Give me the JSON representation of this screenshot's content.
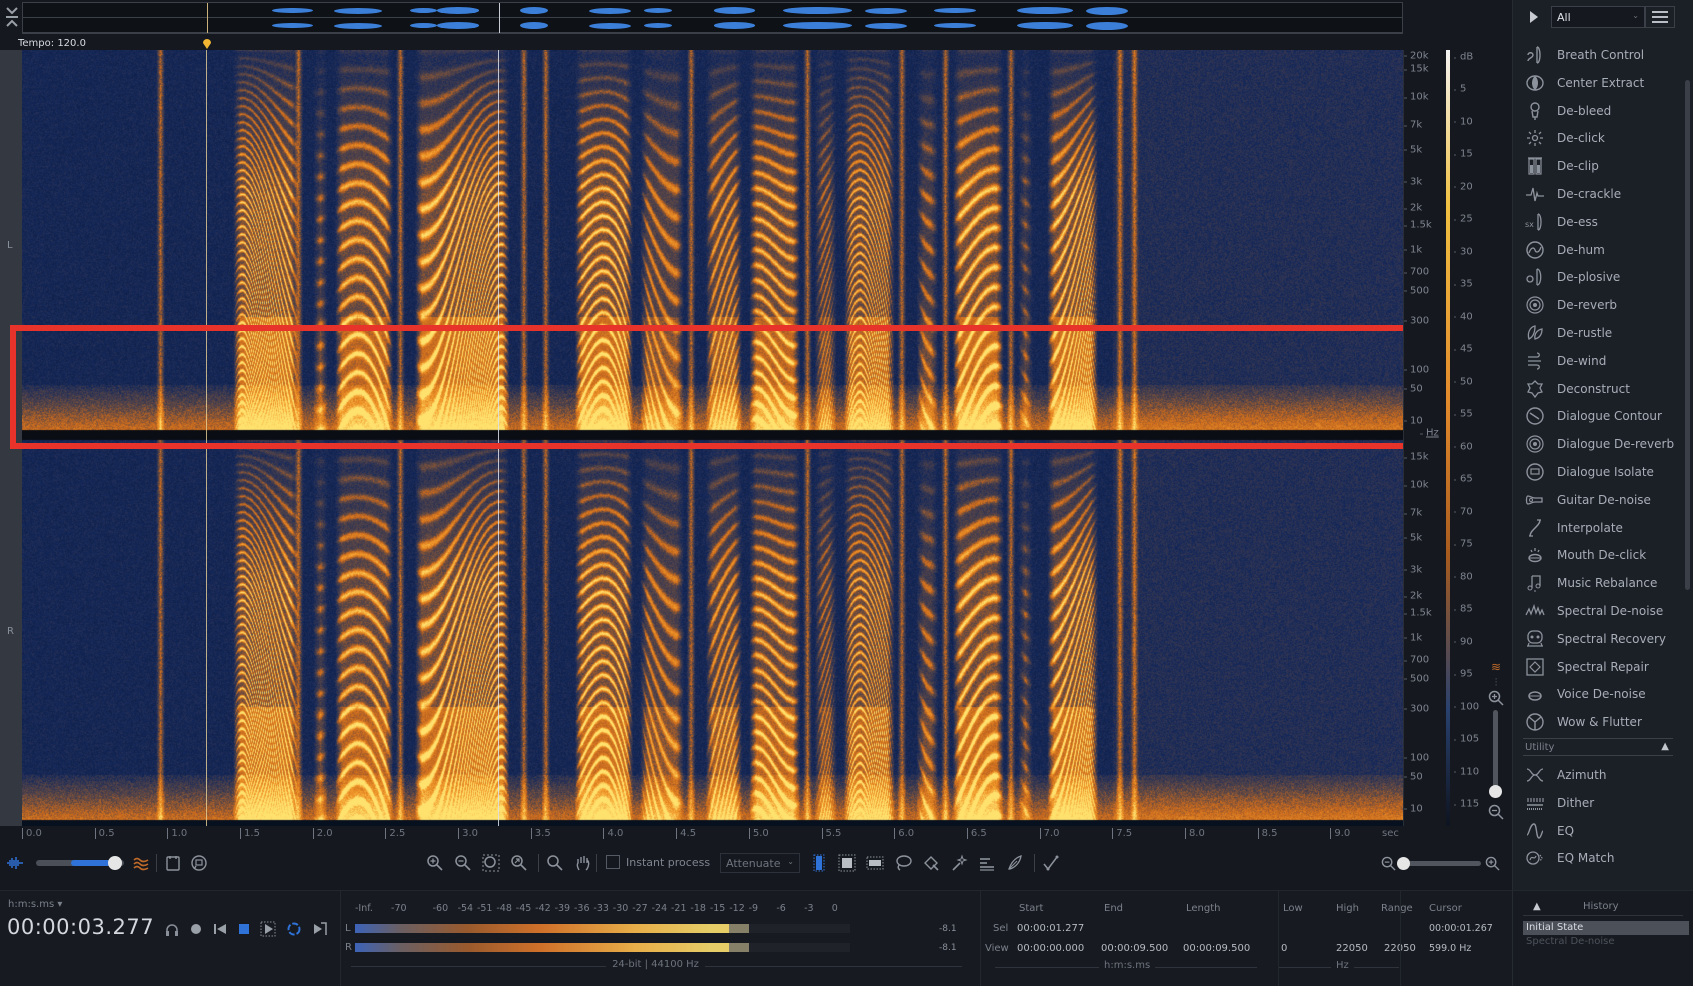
{
  "overview": {
    "collapse_icon": "collapse-expand-icon",
    "segments": [
      {
        "start": 0.18,
        "end": 0.21,
        "h": 0.5
      },
      {
        "start": 0.225,
        "end": 0.26,
        "h": 0.6
      },
      {
        "start": 0.28,
        "end": 0.3,
        "h": 0.4
      },
      {
        "start": 0.3,
        "end": 0.33,
        "h": 0.7
      },
      {
        "start": 0.36,
        "end": 0.38,
        "h": 0.8
      },
      {
        "start": 0.41,
        "end": 0.44,
        "h": 0.6
      },
      {
        "start": 0.45,
        "end": 0.47,
        "h": 0.4
      },
      {
        "start": 0.5,
        "end": 0.53,
        "h": 0.7
      },
      {
        "start": 0.55,
        "end": 0.6,
        "h": 0.9
      },
      {
        "start": 0.61,
        "end": 0.64,
        "h": 0.6
      },
      {
        "start": 0.66,
        "end": 0.69,
        "h": 0.5
      },
      {
        "start": 0.72,
        "end": 0.76,
        "h": 0.9
      },
      {
        "start": 0.77,
        "end": 0.8,
        "h": 1.0
      }
    ]
  },
  "tempo": {
    "label": "Tempo: 120.0"
  },
  "channels": {
    "left": "L",
    "right": "R"
  },
  "spectrogram": {
    "duration_sec": 9.5,
    "cursor_sec": 1.267,
    "playhead_sec": 3.277,
    "selection": {
      "label": "Selected frequency band (red box)",
      "low_hz": 10,
      "high_hz": 300
    }
  },
  "freq_axis": {
    "top_channel": [
      "20k",
      "15k",
      "10k",
      "7k",
      "5k",
      "3k",
      "2k",
      "1.5k",
      "1k",
      "700",
      "500",
      "300",
      "100",
      "50",
      "10"
    ],
    "bottom_channel": [
      "15k",
      "10k",
      "7k",
      "5k",
      "3k",
      "2k",
      "1.5k",
      "1k",
      "700",
      "500",
      "300",
      "100",
      "50",
      "10"
    ],
    "unit": "Hz"
  },
  "db_axis": {
    "unit": "dB",
    "labels": [
      "5",
      "10",
      "15",
      "20",
      "25",
      "30",
      "35",
      "40",
      "45",
      "50",
      "55",
      "60",
      "65",
      "70",
      "75",
      "80",
      "85",
      "90",
      "95",
      "100",
      "105",
      "110",
      "115"
    ]
  },
  "time_ruler": {
    "labels": [
      "0.0",
      "0.5",
      "1.0",
      "1.5",
      "2.0",
      "2.5",
      "3.0",
      "3.5",
      "4.0",
      "4.5",
      "5.0",
      "5.5",
      "6.0",
      "6.5",
      "7.0",
      "7.5",
      "8.0",
      "8.5",
      "9.0"
    ],
    "unit": "sec"
  },
  "toolbar": {
    "waveform_icon": "waveform-spectrogram-blend-icon",
    "spectrogram_icon": "spectrogram-icon",
    "blend_level": 0.9,
    "instant_process_label": "Instant process",
    "instant_process_checked": false,
    "mode_value": "Attenuate",
    "zoom_tools": [
      "zoom-in-icon",
      "zoom-out-icon",
      "zoom-selection-icon",
      "zoom-fit-icon",
      "magnify-icon",
      "hand-icon"
    ],
    "select_tools": [
      "time-select-icon",
      "time-freq-select-icon",
      "freq-select-icon",
      "lasso-icon",
      "brush-icon",
      "magic-wand-icon",
      "harmonic-select-icon",
      "find-similar-icon",
      "pencil-curve-icon"
    ]
  },
  "transport": {
    "time_format": "h:m:s.ms ▾",
    "time": "00:00:03.277",
    "buttons": [
      "headphones-icon",
      "record-icon",
      "rewind-icon",
      "stop-icon",
      "play-selection-icon",
      "loop-icon",
      "play-from-cursor-icon"
    ]
  },
  "meter": {
    "scale": [
      "-Inf.",
      "-70",
      "-60",
      "-54",
      "-51",
      "-48",
      "-45",
      "-42",
      "-39",
      "-36",
      "-33",
      "-30",
      "-27",
      "-24",
      "-21",
      "-18",
      "-15",
      "-12",
      "-9",
      "-6",
      "-3",
      "0"
    ],
    "left": {
      "label": "L",
      "level_db": -12,
      "peak_db": -9,
      "value": "-8.1"
    },
    "right": {
      "label": "R",
      "level_db": -12,
      "peak_db": -9,
      "value": "-8.1"
    },
    "format": "24-bit | 44100 Hz"
  },
  "selection_info": {
    "headers": {
      "start": "Start",
      "end": "End",
      "length": "Length",
      "low": "Low",
      "high": "High",
      "range": "Range",
      "cursor": "Cursor"
    },
    "sel": {
      "label": "Sel",
      "start": "00:00:01.277"
    },
    "view": {
      "label": "View",
      "start": "00:00:00.000",
      "end": "00:00:09.500",
      "length": "00:00:09.500",
      "low": "0",
      "high": "22050",
      "range": "22050"
    },
    "cursor_time": "00:00:01.267",
    "cursor_freq": "599.0 Hz",
    "time_unit": "h:m:s.ms",
    "freq_unit": "Hz"
  },
  "modules": {
    "filter_value": "All",
    "items": [
      {
        "label": "Breath Control",
        "icon": "breath-control-icon"
      },
      {
        "label": "Center Extract",
        "icon": "center-extract-icon"
      },
      {
        "label": "De-bleed",
        "icon": "de-bleed-icon"
      },
      {
        "label": "De-click",
        "icon": "de-click-icon"
      },
      {
        "label": "De-clip",
        "icon": "de-clip-icon"
      },
      {
        "label": "De-crackle",
        "icon": "de-crackle-icon"
      },
      {
        "label": "De-ess",
        "icon": "de-ess-icon"
      },
      {
        "label": "De-hum",
        "icon": "de-hum-icon"
      },
      {
        "label": "De-plosive",
        "icon": "de-plosive-icon"
      },
      {
        "label": "De-reverb",
        "icon": "de-reverb-icon"
      },
      {
        "label": "De-rustle",
        "icon": "de-rustle-icon"
      },
      {
        "label": "De-wind",
        "icon": "de-wind-icon"
      },
      {
        "label": "Deconstruct",
        "icon": "deconstruct-icon"
      },
      {
        "label": "Dialogue Contour",
        "icon": "dialogue-contour-icon"
      },
      {
        "label": "Dialogue De-reverb",
        "icon": "dialogue-de-reverb-icon"
      },
      {
        "label": "Dialogue Isolate",
        "icon": "dialogue-isolate-icon"
      },
      {
        "label": "Guitar De-noise",
        "icon": "guitar-de-noise-icon"
      },
      {
        "label": "Interpolate",
        "icon": "interpolate-icon"
      },
      {
        "label": "Mouth De-click",
        "icon": "mouth-de-click-icon"
      },
      {
        "label": "Music Rebalance",
        "icon": "music-rebalance-icon"
      },
      {
        "label": "Spectral De-noise",
        "icon": "spectral-de-noise-icon"
      },
      {
        "label": "Spectral Recovery",
        "icon": "spectral-recovery-icon"
      },
      {
        "label": "Spectral Repair",
        "icon": "spectral-repair-icon"
      },
      {
        "label": "Voice De-noise",
        "icon": "voice-de-noise-icon"
      },
      {
        "label": "Wow & Flutter",
        "icon": "wow-flutter-icon"
      }
    ],
    "utility_header": "Utility",
    "utility_items": [
      {
        "label": "Azimuth",
        "icon": "azimuth-icon"
      },
      {
        "label": "Dither",
        "icon": "dither-icon"
      },
      {
        "label": "EQ",
        "icon": "eq-icon"
      },
      {
        "label": "EQ Match",
        "icon": "eq-match-icon"
      }
    ]
  },
  "history": {
    "title": "History",
    "items": [
      {
        "label": "Initial State",
        "selected": true
      },
      {
        "label": "Spectral De-noise",
        "selected": false
      }
    ]
  },
  "colors": {
    "selection": "#e8332a",
    "spectro_low": "#07101f",
    "spectro_high": "#ffd65a",
    "accent": "#2f72d8"
  }
}
